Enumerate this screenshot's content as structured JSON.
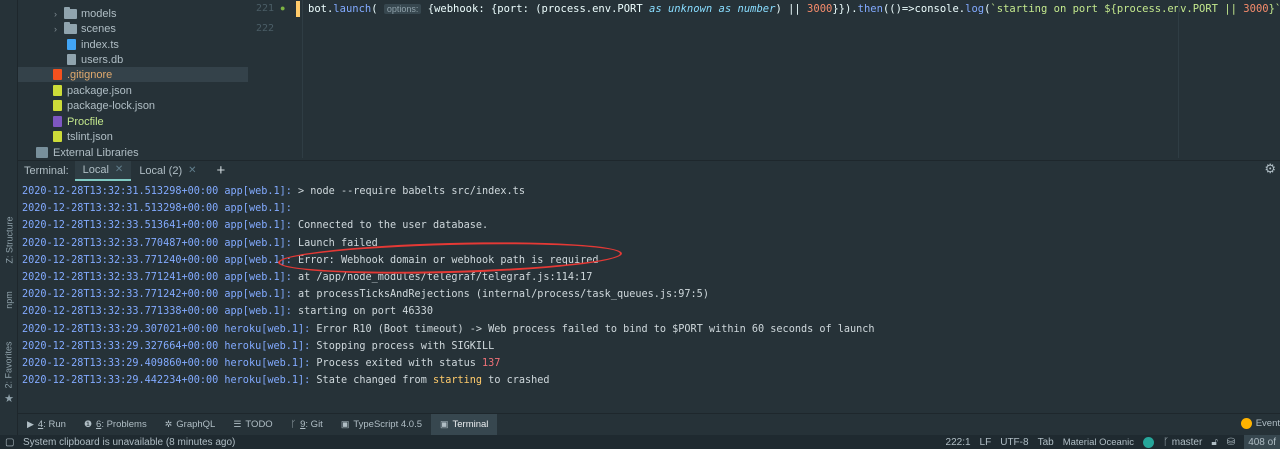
{
  "tree": {
    "items": [
      {
        "label": "models",
        "type": "folder"
      },
      {
        "label": "scenes",
        "type": "folder"
      },
      {
        "label": "index.ts",
        "type": "ts"
      },
      {
        "label": "users.db",
        "type": "db"
      },
      {
        "label": ".gitignore",
        "type": "git"
      },
      {
        "label": "package.json",
        "type": "json"
      },
      {
        "label": "package-lock.json",
        "type": "json"
      },
      {
        "label": "Procfile",
        "type": "proc"
      },
      {
        "label": "tslint.json",
        "type": "json"
      },
      {
        "label": "External Libraries",
        "type": "lib"
      }
    ]
  },
  "editor": {
    "line_numbers": [
      "221",
      "222"
    ],
    "code": {
      "p1": "bot.",
      "fn1": "launch",
      "p2": "( ",
      "hint": "options:",
      "p3": " {webhook: {port: (process.env.PORT ",
      "it1": "as unknown as number",
      "p4": ") || ",
      "num1": "3000",
      "p5": "}}).",
      "fn2": "then",
      "p6": "(()=>",
      "p7": "console.",
      "fn3": "log",
      "p8": "(",
      "str1": "`starting on port ${process.env.PORT || ",
      "num2": "3000",
      "str2": "}`",
      "p9": "));"
    }
  },
  "terminal": {
    "label": "Terminal:",
    "tabs": [
      {
        "label": "Local"
      },
      {
        "label": "Local (2)"
      }
    ],
    "lines": [
      {
        "ts": "2020-12-28T13:32:31.513298+00:00",
        "src": "app[web.1]:",
        "parts": [
          {
            "t": "> node --require babelts src/index.ts",
            "c": "msg"
          }
        ]
      },
      {
        "ts": "2020-12-28T13:32:31.513298+00:00",
        "src": "app[web.1]:",
        "parts": []
      },
      {
        "ts": "2020-12-28T13:32:33.513641+00:00",
        "src": "app[web.1]:",
        "parts": [
          {
            "t": "Connected to the user database.",
            "c": "msg"
          }
        ]
      },
      {
        "ts": "2020-12-28T13:32:33.770487+00:00",
        "src": "app[web.1]:",
        "parts": [
          {
            "t": "Launch failed",
            "c": "msg"
          }
        ]
      },
      {
        "ts": "2020-12-28T13:32:33.771240+00:00",
        "src": "app[web.1]:",
        "parts": [
          {
            "t": "Error: Webhook domain or webhook path is required",
            "c": "msg"
          }
        ]
      },
      {
        "ts": "2020-12-28T13:32:33.771241+00:00",
        "src": "app[web.1]:",
        "parts": [
          {
            "t": "at /app/node_modules/telegraf/telegraf.js:114:17",
            "c": "msg"
          }
        ]
      },
      {
        "ts": "2020-12-28T13:32:33.771242+00:00",
        "src": "app[web.1]:",
        "parts": [
          {
            "t": "at processTicksAndRejections (internal/process/task_queues.js:97:5)",
            "c": "msg"
          }
        ]
      },
      {
        "ts": "2020-12-28T13:32:33.771338+00:00",
        "src": "app[web.1]:",
        "parts": [
          {
            "t": "starting on port 46330",
            "c": "msg"
          }
        ]
      },
      {
        "ts": "2020-12-28T13:33:29.307021+00:00",
        "src": "heroku[web.1]:",
        "parts": [
          {
            "t": "Error R10 (Boot timeout) -> Web process failed to bind to $PORT within 60 seconds of launch",
            "c": "msg"
          }
        ]
      },
      {
        "ts": "2020-12-28T13:33:29.327664+00:00",
        "src": "heroku[web.1]:",
        "parts": [
          {
            "t": "Stopping process with SIGKILL",
            "c": "msg"
          }
        ]
      },
      {
        "ts": "2020-12-28T13:33:29.409860+00:00",
        "src": "heroku[web.1]:",
        "parts": [
          {
            "t": "Process exited with status ",
            "c": "msg"
          },
          {
            "t": "137",
            "c": "red"
          }
        ]
      },
      {
        "ts": "2020-12-28T13:33:29.442234+00:00",
        "src": "heroku[web.1]:",
        "parts": [
          {
            "t": "State changed from ",
            "c": "msg"
          },
          {
            "t": "starting",
            "c": "yel"
          },
          {
            "t": " to crashed",
            "c": "msg"
          }
        ]
      }
    ]
  },
  "side_tabs": {
    "structure": "Z: Structure",
    "npm": "npm",
    "favorites": "2: Favorites"
  },
  "toolbar": {
    "items": [
      {
        "key": "4",
        "label": ": Run",
        "icon": "run-icon"
      },
      {
        "key": "6",
        "label": ": Problems",
        "icon": "problems-icon"
      },
      {
        "key": "",
        "label": "GraphQL",
        "icon": "graphql-icon"
      },
      {
        "key": "",
        "label": "TODO",
        "icon": "todo-icon"
      },
      {
        "key": "9",
        "label": ": Git",
        "icon": "git-icon"
      },
      {
        "key": "",
        "label": "TypeScript 4.0.5",
        "icon": "typescript-icon"
      },
      {
        "key": "",
        "label": "Terminal",
        "icon": "terminal-icon"
      }
    ],
    "events": "Event"
  },
  "status": {
    "message": "System clipboard is unavailable (8 minutes ago)",
    "position": "222:1",
    "line_sep": "LF",
    "encoding": "UTF-8",
    "indent": "Tab",
    "theme": "Material Oceanic",
    "branch": "master",
    "lines": "408 of"
  },
  "colors": {
    "accent": "#80cbc4",
    "highlight_circle": "#e53935",
    "timestamp": "#82aaff"
  }
}
